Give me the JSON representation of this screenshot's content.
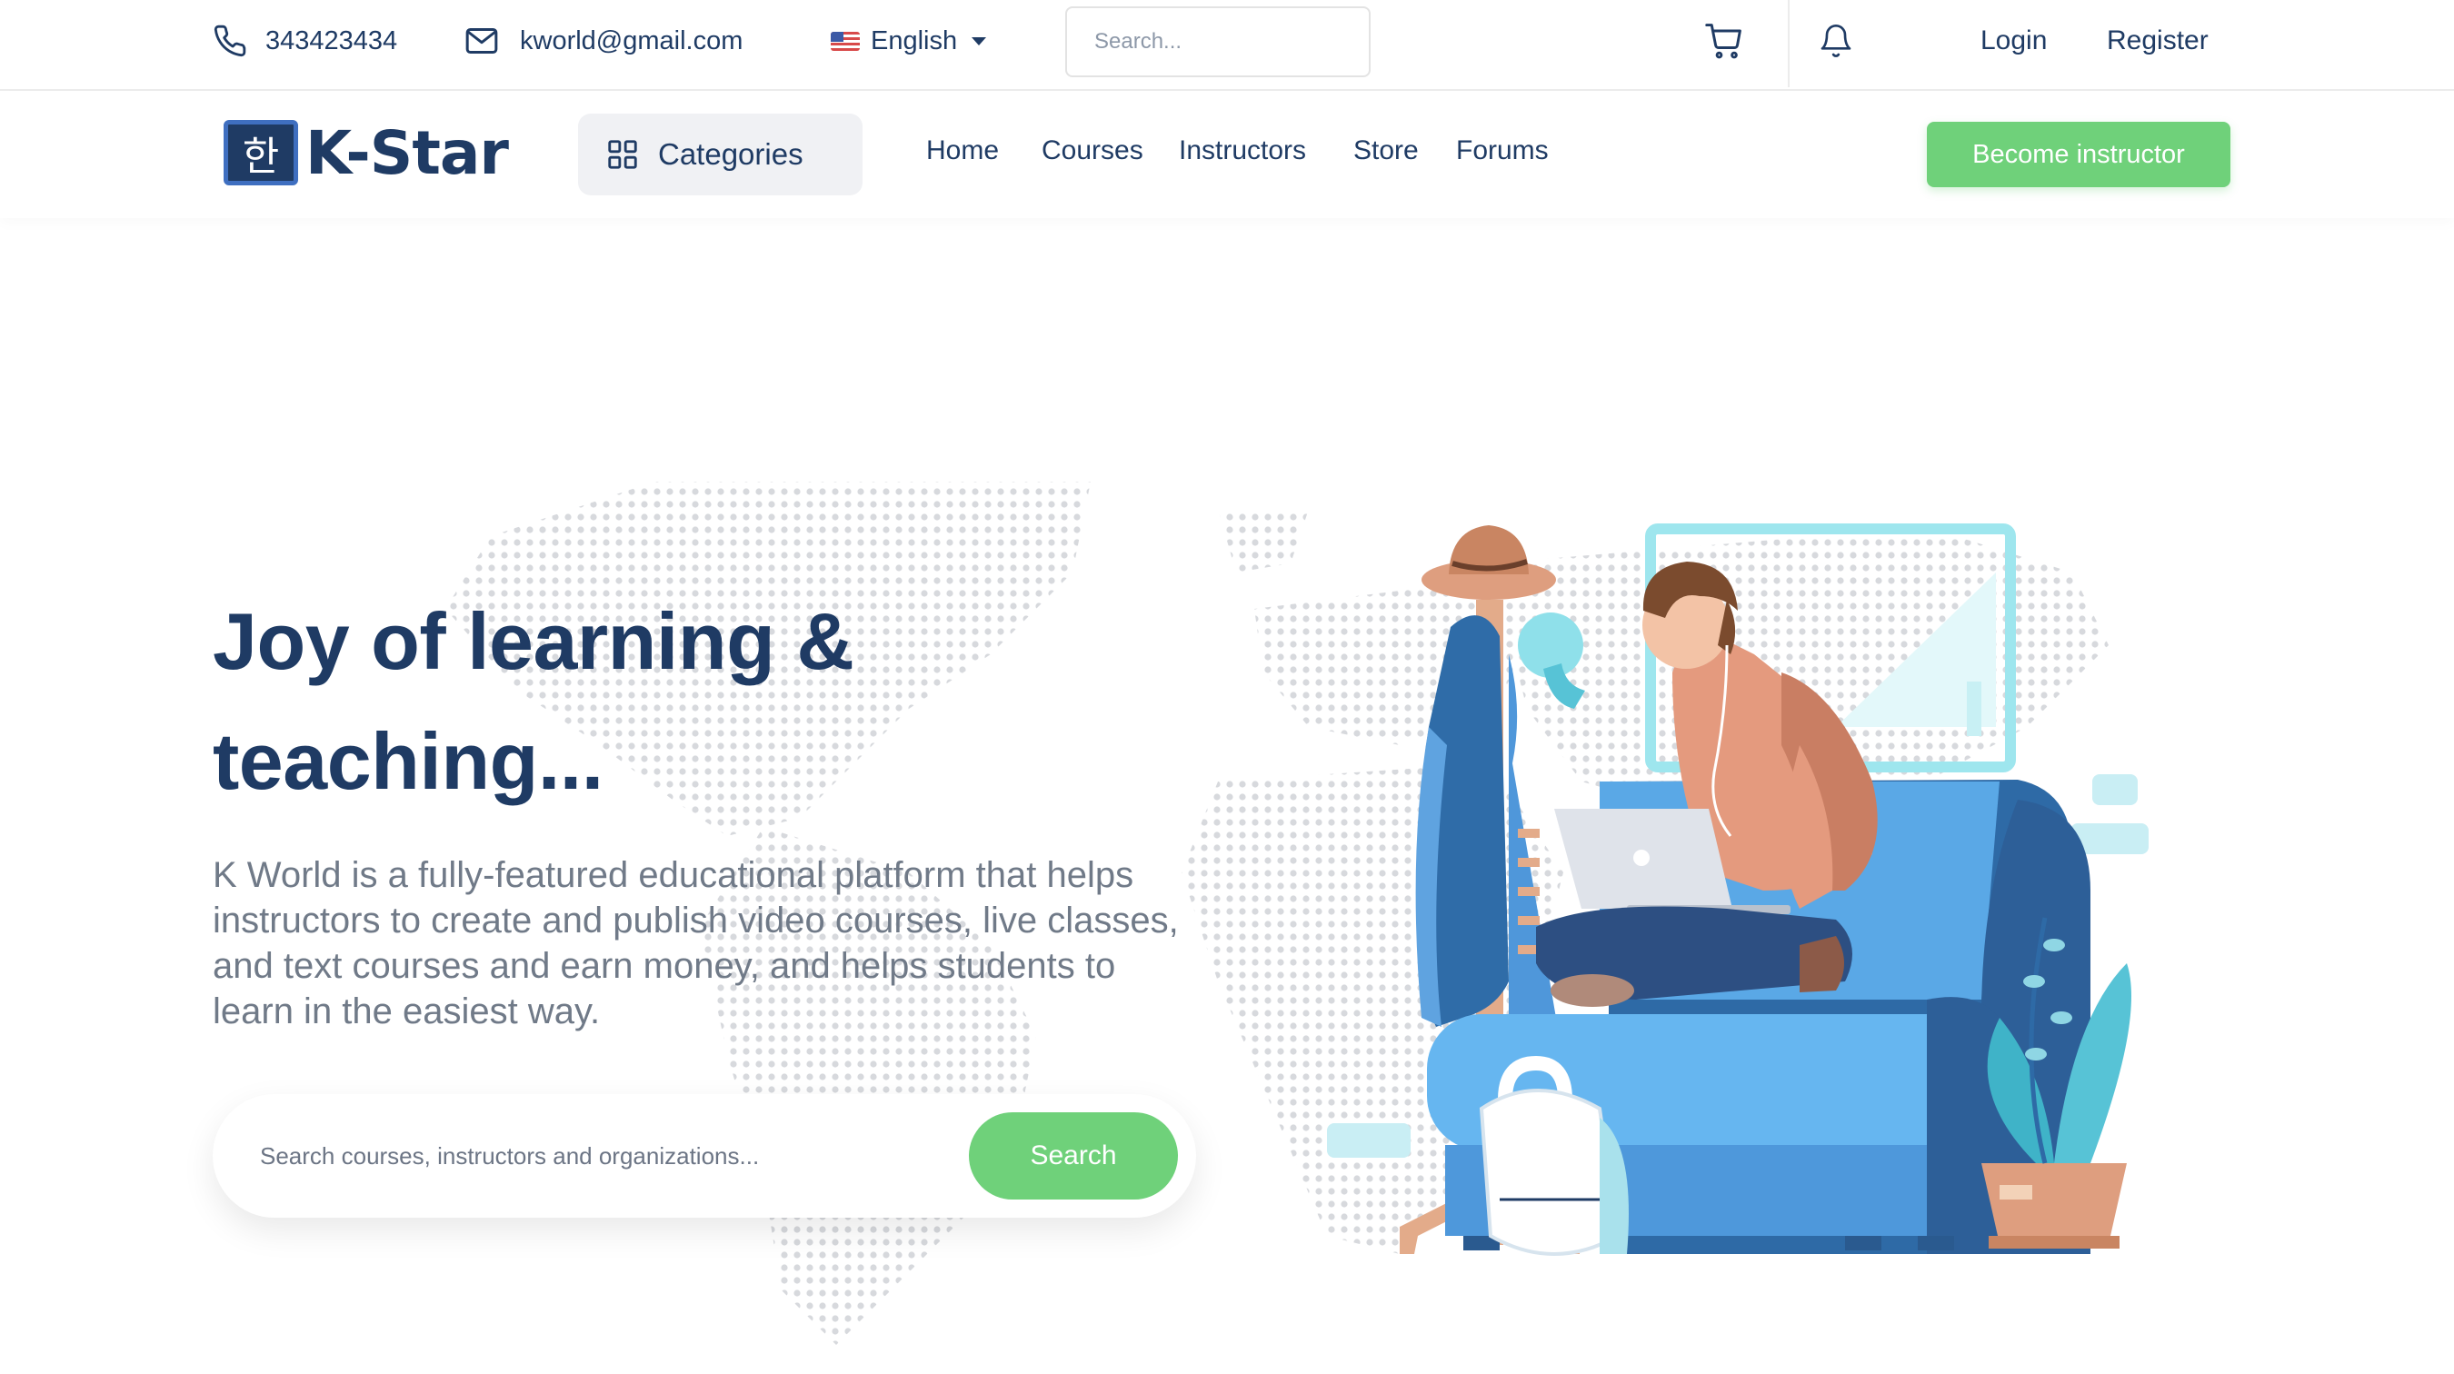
{
  "topbar": {
    "phone": "343423434",
    "email": "kworld@gmail.com",
    "language": "English",
    "search_placeholder": "Search...",
    "login": "Login",
    "register": "Register",
    "icons": [
      "phone-icon",
      "mail-icon",
      "flag-icon",
      "search-icon",
      "cart-icon",
      "bell-icon"
    ]
  },
  "navbar": {
    "logo_glyph": "한",
    "logo_text": "K-Star",
    "categories": "Categories",
    "links": [
      "Home",
      "Courses",
      "Instructors",
      "Store",
      "Forums"
    ],
    "cta": "Become instructor"
  },
  "hero": {
    "title_line1": "Joy of learning &",
    "title_line2": "teaching...",
    "description": "K World is a fully-featured educational platform that helps instructors to create and publish video courses, live classes, and text courses and earn money, and helps students to learn in the easiest way.",
    "search_placeholder": "Search courses, instructors and organizations...",
    "search_button": "Search"
  },
  "colors": {
    "primary": "#1f3b64",
    "accent": "#6fd17a",
    "muted_text": "#707a88",
    "border": "#ececec"
  }
}
